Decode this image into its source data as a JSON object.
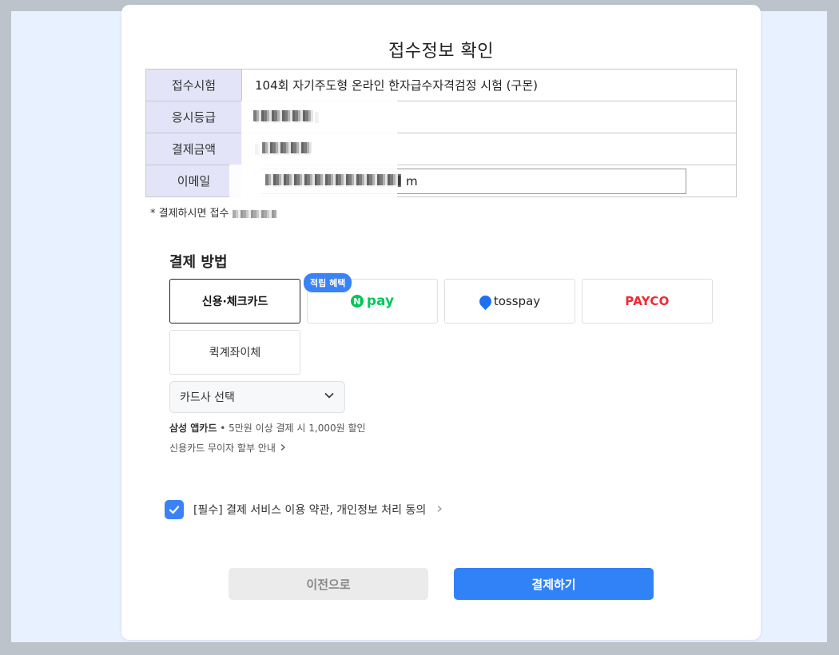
{
  "title": "접수정보 확인",
  "info_rows": {
    "exam_label": "접수시험",
    "exam_value": "104회 자기주도형 온라인 한자급수자격검정 시험 (구몬)",
    "grade_label": "응시등급",
    "amount_label": "결제금액",
    "email_label": "이메일",
    "email_tail": "m"
  },
  "note": "* 결제하시면 접수",
  "payment": {
    "section_title": "결제 방법",
    "card_label": "신용·체크카드",
    "badge": "적립 혜택",
    "npay_n": "N",
    "npay_label": "pay",
    "toss_label": "tosspay",
    "payco_label": "PAYCO",
    "transfer_label": "퀵계좌이체",
    "card_select": "카드사 선택",
    "promo_bold": "삼성 앱카드",
    "promo_text": " • 5만원 이상 결제 시 1,000원 할인",
    "installment": "신용카드 무이자 할부 안내"
  },
  "agreement": {
    "text": "[필수] 결제 서비스 이용 약관, 개인정보 처리 동의",
    "checked": true
  },
  "buttons": {
    "prev": "이전으로",
    "pay": "결제하기"
  },
  "colors": {
    "accent": "#3182f6",
    "label_bg": "#e3e4f7",
    "npay_green": "#03c75a",
    "payco_red": "#ee2a33"
  }
}
